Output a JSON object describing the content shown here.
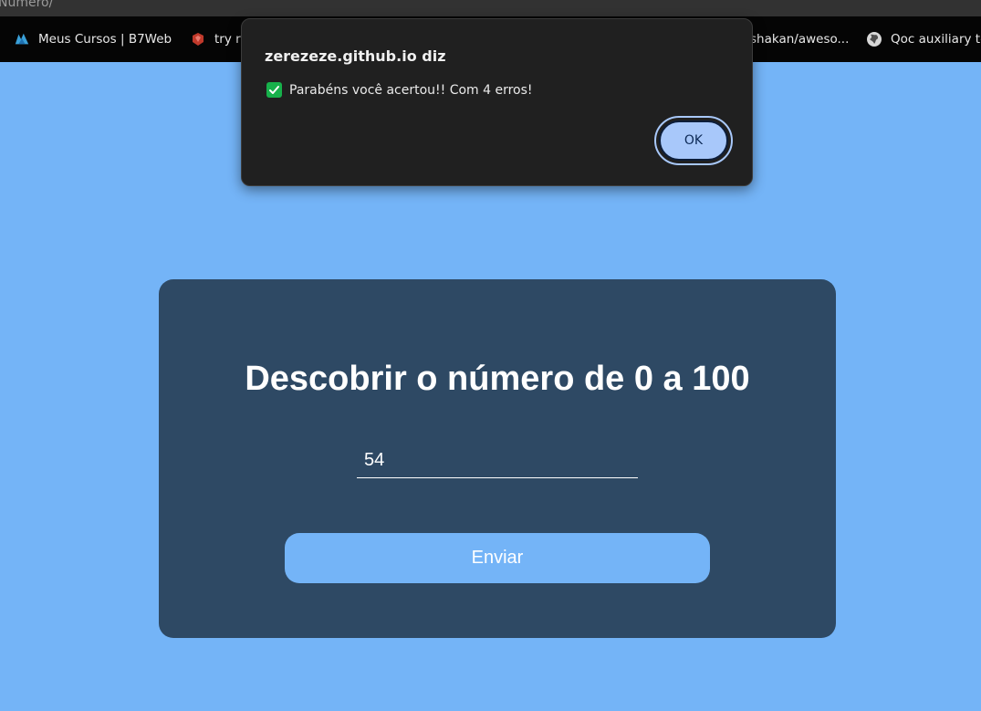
{
  "browser": {
    "tab_title": "Número/",
    "bookmarks": [
      {
        "label": "Meus Cursos | B7Web",
        "icon": "b7web-icon"
      },
      {
        "label": "try r",
        "icon": "ruby-icon"
      },
      {
        "label": "shakan/aweso...",
        "icon": ""
      },
      {
        "label": "Qoc auxiliary to",
        "icon": "globe-icon"
      }
    ]
  },
  "dialog": {
    "title": "zerezeze.github.io diz",
    "message": "Parabéns você acertou!! Com 4 erros!",
    "ok_label": "OK"
  },
  "game": {
    "heading": "Descobrir o número de 0 a 100",
    "input_value": "54",
    "submit_label": "Enviar"
  },
  "colors": {
    "page_background": "#74b4f7",
    "card_background": "#2e4964",
    "dialog_background": "#202020",
    "ok_button": "#a8c8fa",
    "check_green": "#17b14b"
  }
}
